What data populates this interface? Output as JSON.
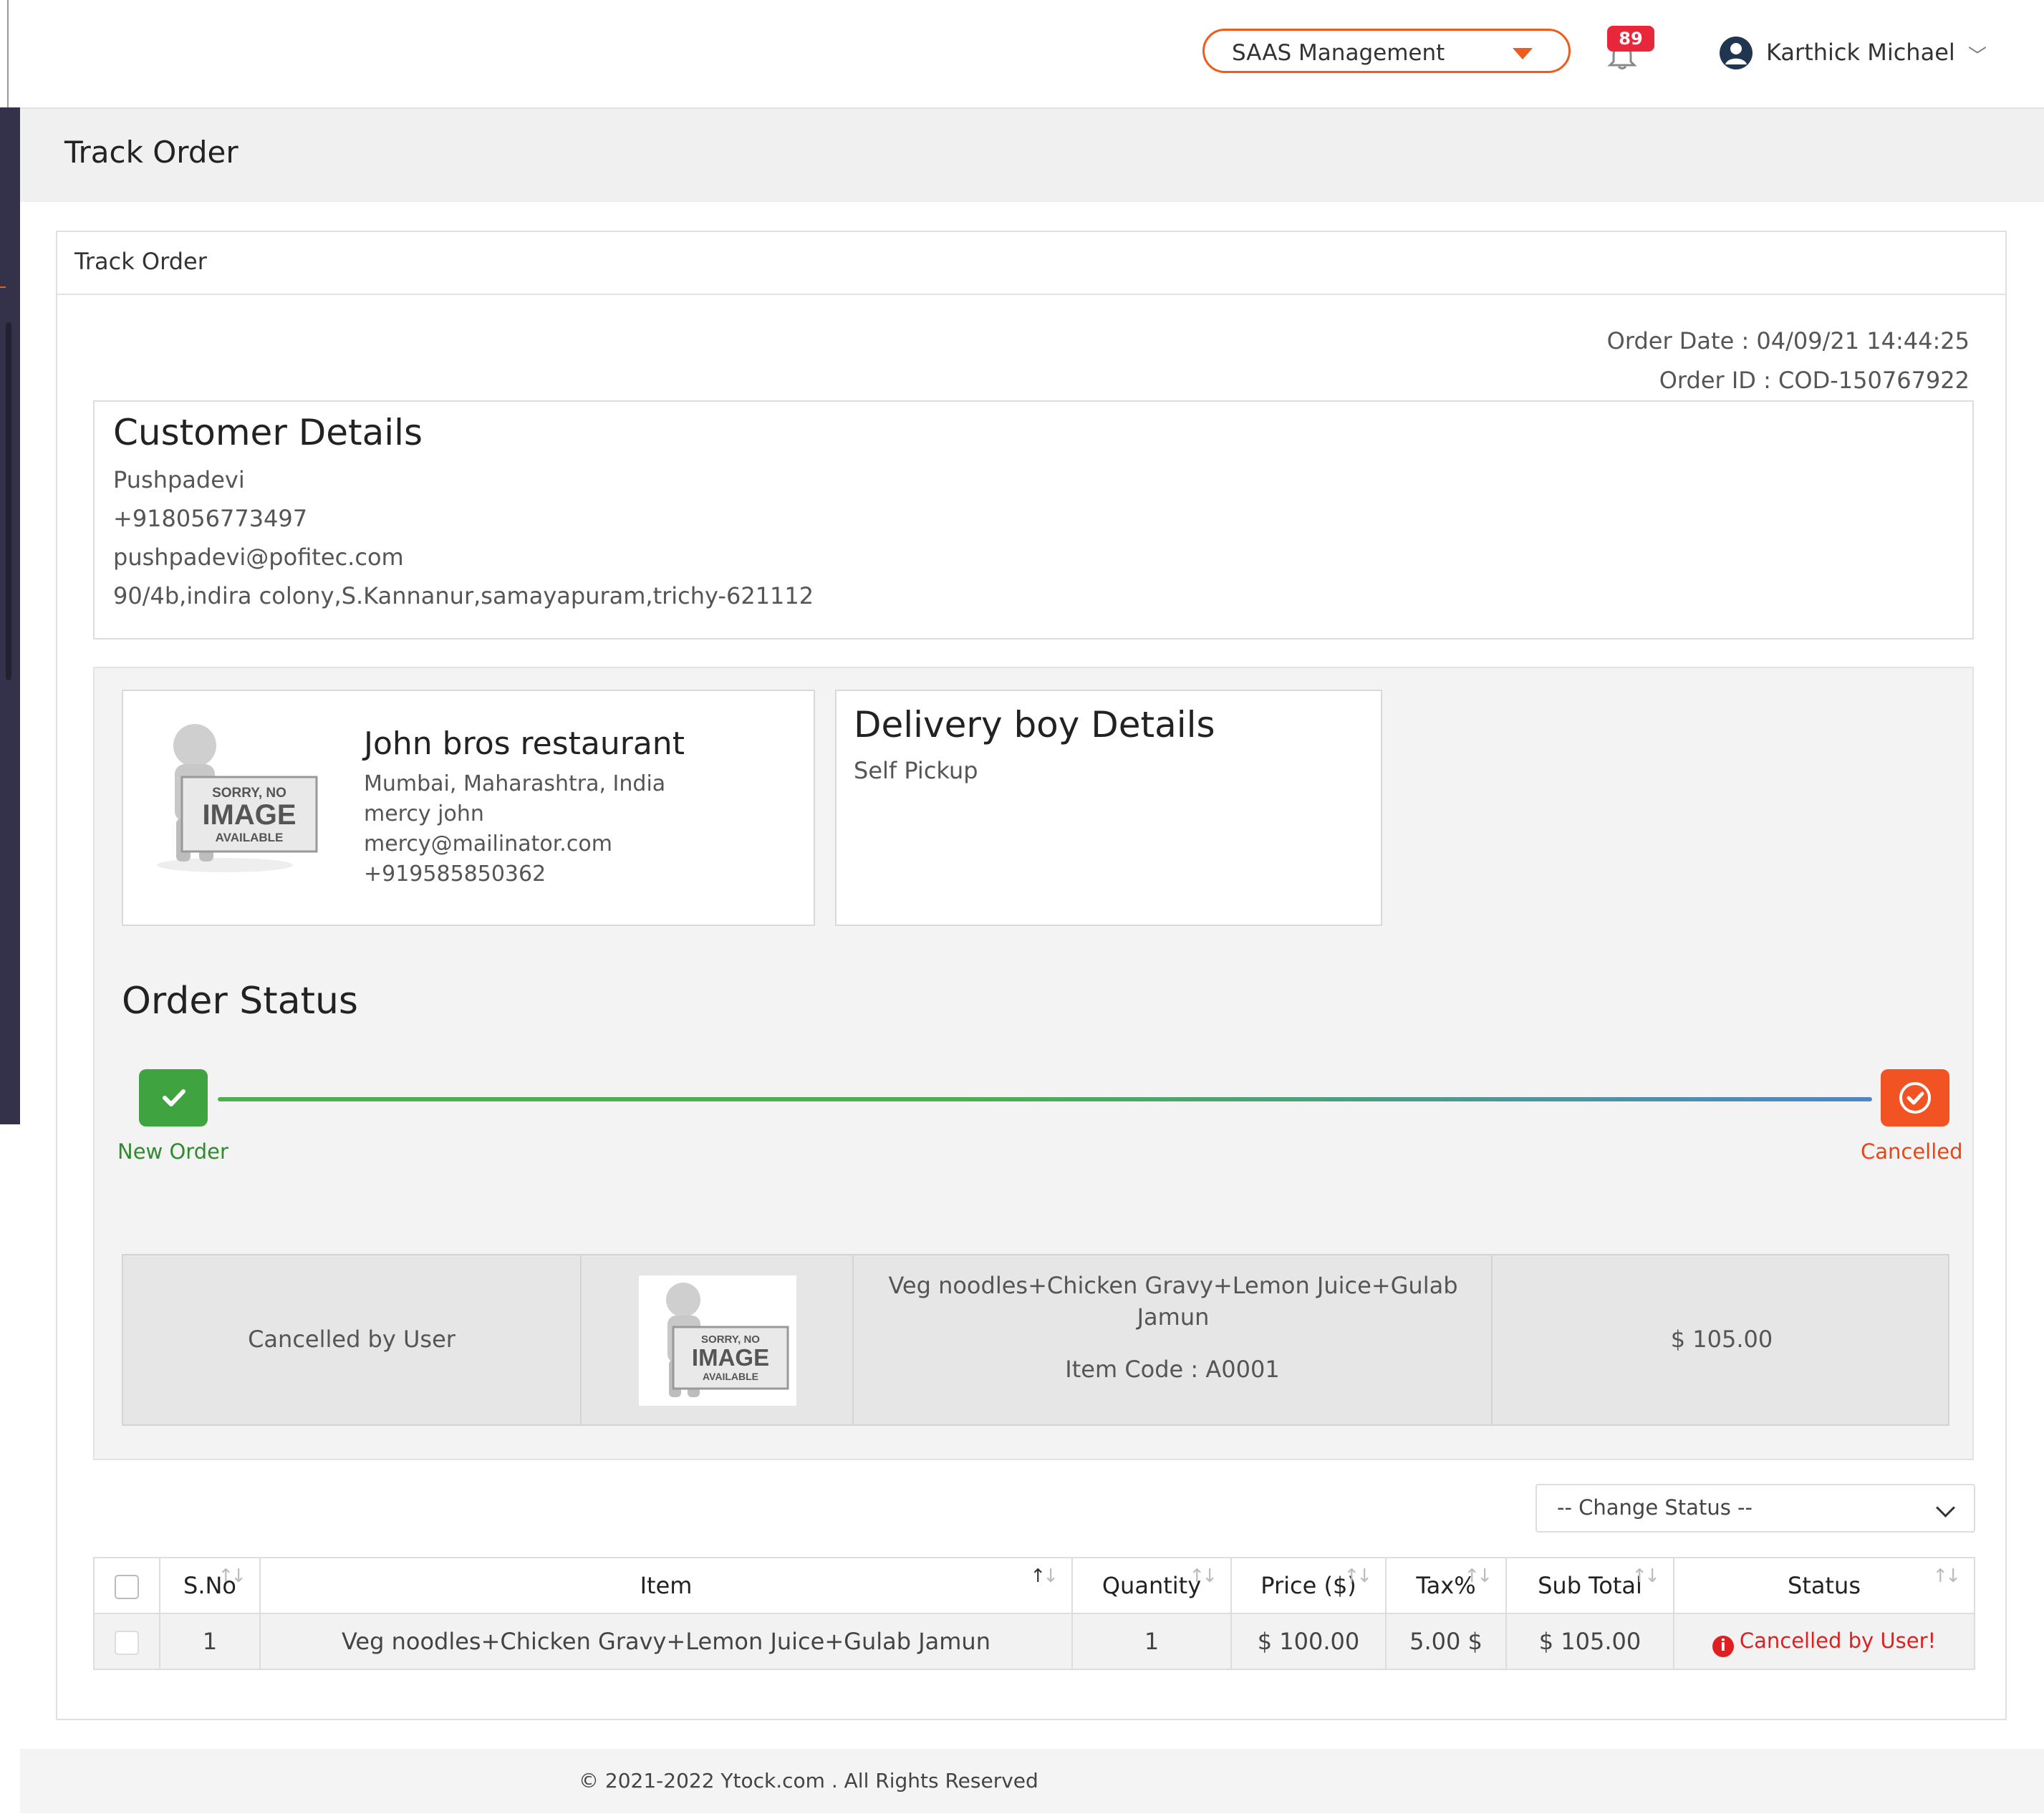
{
  "header": {
    "workspace_select": "SAAS Management",
    "notification_count": "89",
    "user_name": "Karthick Michael"
  },
  "page": {
    "title": "Track Order"
  },
  "card": {
    "title": "Track Order",
    "order_date": "Order Date : 04/09/21 14:44:25",
    "order_id": "Order ID : COD-150767922"
  },
  "customer": {
    "heading": "Customer Details",
    "name": "Pushpadevi",
    "phone": "+918056773497",
    "email": "pushpadevi@pofitec.com",
    "address": "90/4b,indira colony,S.Kannanur,samayapuram,trichy-621112"
  },
  "restaurant": {
    "name": "John bros restaurant",
    "location": "Mumbai, Maharashtra, India",
    "contact": "mercy john",
    "email": "mercy@mailinator.com",
    "phone": "+919585850362"
  },
  "delivery": {
    "heading": "Delivery boy Details",
    "value": "Self Pickup"
  },
  "no_image": {
    "line1": "SORRY, NO",
    "line2": "IMAGE",
    "line3": "AVAILABLE"
  },
  "order_status": {
    "heading": "Order Status",
    "steps": [
      {
        "label": "New Order",
        "color": "#3fa33f"
      },
      {
        "label": "Cancelled",
        "color": "#f25322"
      }
    ]
  },
  "item_summary": {
    "status": "Cancelled by User",
    "item_name": "Veg noodles+Chicken Gravy+Lemon Juice+Gulab Jamun",
    "item_code": "Item Code : A0001",
    "amount": "$ 105.00"
  },
  "change_status": {
    "placeholder": "-- Change Status --"
  },
  "table": {
    "columns": [
      "S.No",
      "Item",
      "Quantity",
      "Price ($)",
      "Tax%",
      "Sub Total",
      "Status"
    ],
    "rows": [
      {
        "sno": "1",
        "item": "Veg noodles+Chicken Gravy+Lemon Juice+Gulab Jamun",
        "quantity": "1",
        "price": "$ 100.00",
        "tax": "5.00 $",
        "subtotal": "$ 105.00",
        "status": "Cancelled by User!"
      }
    ]
  },
  "footer": {
    "text": "© 2021-2022 Ytock.com . All Rights Reserved"
  },
  "colors": {
    "accent": "#f05a1a",
    "success": "#3fa33f",
    "danger": "#e02020",
    "sidebar": "#33324a"
  }
}
